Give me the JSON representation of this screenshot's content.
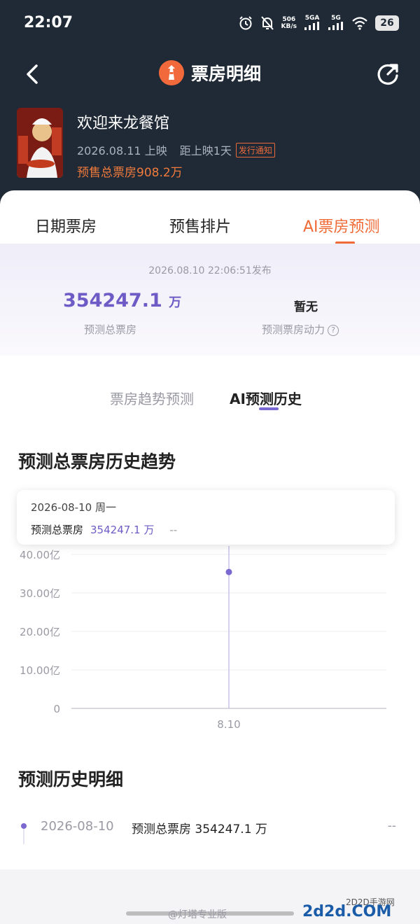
{
  "status_bar": {
    "time": "22:07",
    "speed": "506",
    "speed_unit": "KB/s",
    "network1": "5GA",
    "network2": "5G",
    "battery": "26"
  },
  "header": {
    "title": "票房明细"
  },
  "movie": {
    "name": "欢迎来龙餐馆",
    "release_date": "2026.08.11 上映",
    "countdown": "距上映1天",
    "notice_badge": "发行通知",
    "presale_box_office": "预售总票房908.2万"
  },
  "tabs": [
    {
      "label": "日期票房",
      "active": false
    },
    {
      "label": "预售排片",
      "active": false
    },
    {
      "label": "AI票房预测",
      "active": true
    }
  ],
  "summary": {
    "published": "2026.08.10 22:06:51发布",
    "predicted_total_value": "354247.1",
    "predicted_total_unit": "万",
    "predicted_total_label": "预测总票房",
    "momentum_value": "暂无",
    "momentum_label": "预测票房动力"
  },
  "sub_tabs": [
    {
      "label": "票房趋势预测",
      "active": false
    },
    {
      "label": "AI预测历史",
      "active": true
    }
  ],
  "trend_section": {
    "title": "预测总票房历史趋势"
  },
  "tooltip": {
    "date": "2026-08-10 周一",
    "label": "预测总票房",
    "value": "354247.1 万",
    "change": "--"
  },
  "chart_data": {
    "type": "scatter",
    "x": [
      "8.10"
    ],
    "y_tick_labels": [
      "0",
      "10.00亿",
      "20.00亿",
      "30.00亿",
      "40.00亿"
    ],
    "ylim": [
      0,
      40
    ],
    "y_unit": "亿",
    "series": [
      {
        "values": [
          35.42471
        ]
      }
    ],
    "grid": true,
    "colors": {
      "point": "#7b68d0",
      "line": "#c9c2ec",
      "grid": "#ececf0"
    }
  },
  "history_section": {
    "title": "预测历史明细",
    "rows": [
      {
        "date": "2026-08-10",
        "text": "预测总票房 354247.1 万",
        "change": "--"
      }
    ]
  },
  "watermark": {
    "left": "@灯塔专业版",
    "brand": "2d2d.COM",
    "site": "2D2D手游网"
  },
  "colors": {
    "header_bg": "#1f2a36",
    "accent_orange": "#ef6a35",
    "accent_purple": "#6e5bc5"
  }
}
